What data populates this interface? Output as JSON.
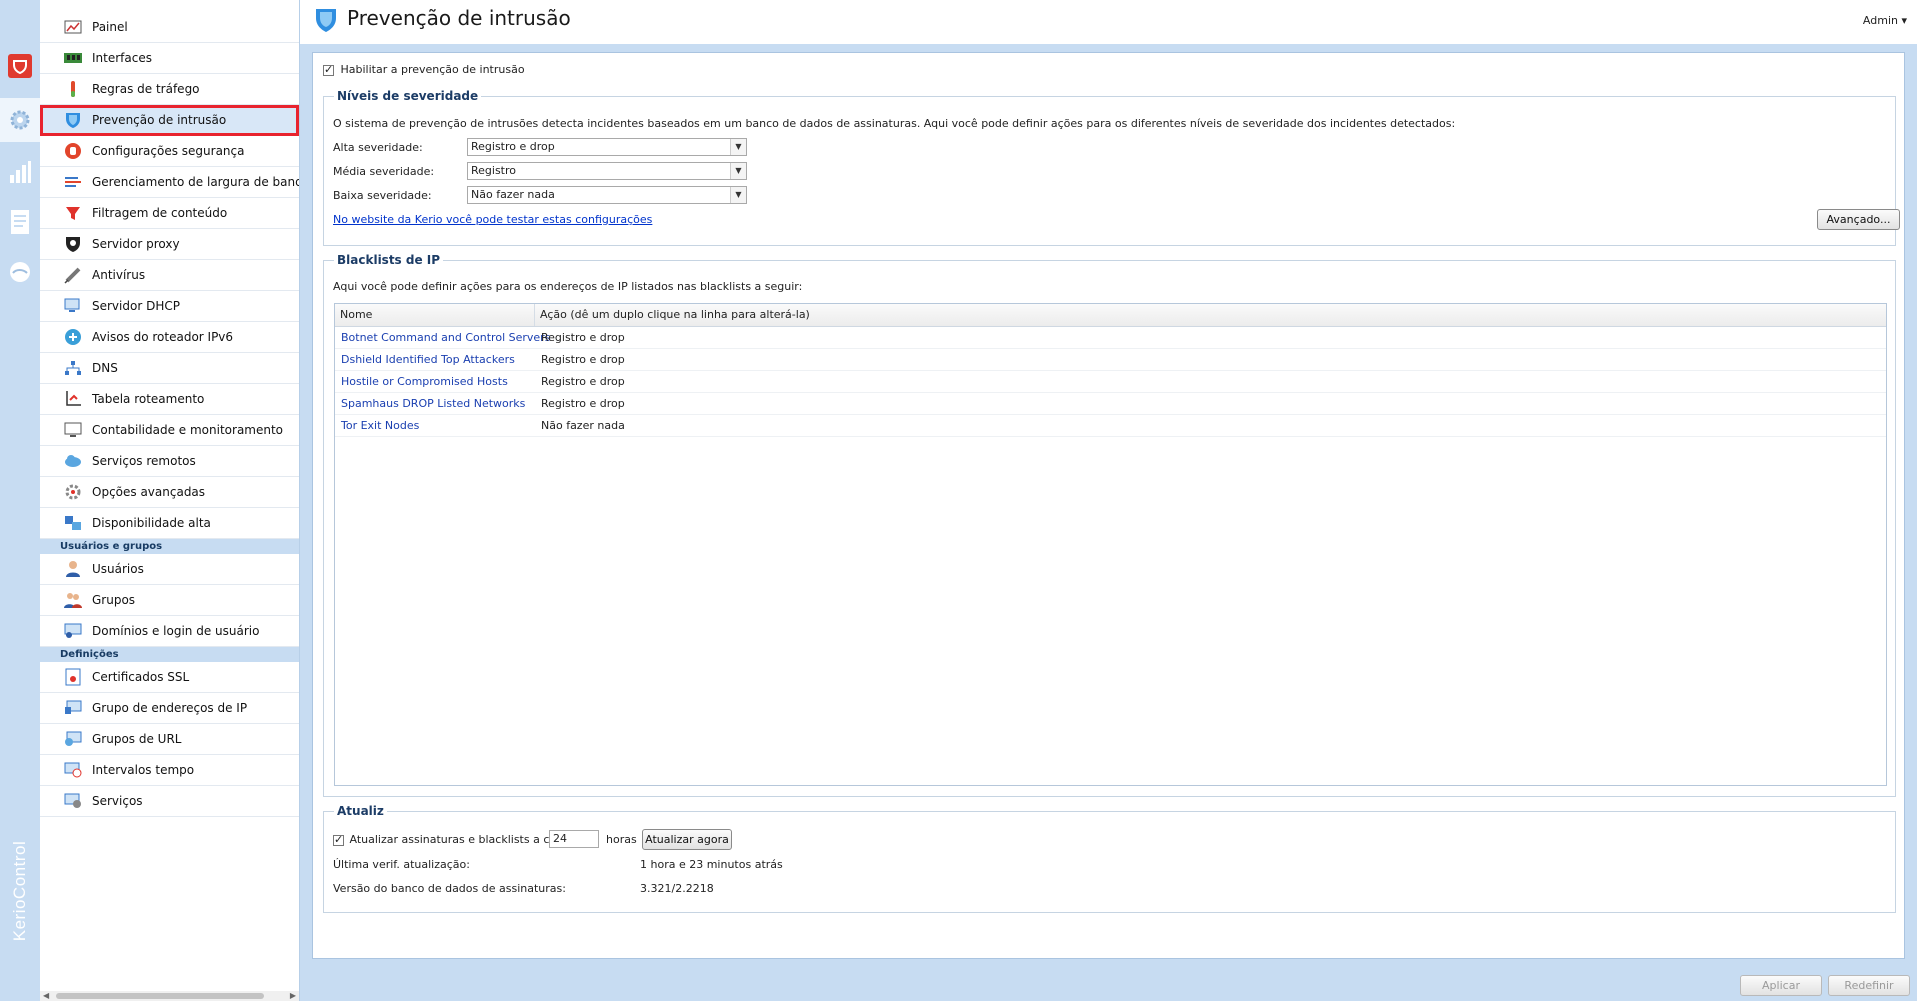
{
  "rail": {
    "brand": "KerioControl",
    "items": [
      "shield-icon",
      "gear-icon",
      "chart-icon",
      "document-icon",
      "bubble-icon"
    ]
  },
  "sidebar": {
    "items": [
      {
        "label": "Painel",
        "icon": "dashboard-icon"
      },
      {
        "label": "Interfaces",
        "icon": "network-card-icon"
      },
      {
        "label": "Regras de tráfego",
        "icon": "traffic-rule-icon"
      },
      {
        "label": "Prevenção de intrusão",
        "icon": "shield-icon"
      },
      {
        "label": "Configurações segurança",
        "icon": "hand-icon"
      },
      {
        "label": "Gerenciamento de largura de banda e QoS",
        "icon": "bandwidth-icon"
      },
      {
        "label": "Filtragem de conteúdo",
        "icon": "funnel-icon"
      },
      {
        "label": "Servidor proxy",
        "icon": "proxy-icon"
      },
      {
        "label": "Antivírus",
        "icon": "syringe-icon"
      },
      {
        "label": "Servidor DHCP",
        "icon": "dhcp-icon"
      },
      {
        "label": "Avisos do roteador IPv6",
        "icon": "router-icon"
      },
      {
        "label": "DNS",
        "icon": "dns-icon"
      },
      {
        "label": "Tabela roteamento",
        "icon": "routing-icon"
      },
      {
        "label": "Contabilidade e monitoramento",
        "icon": "monitor-icon"
      },
      {
        "label": "Serviços remotos",
        "icon": "cloud-icon"
      },
      {
        "label": "Opções avançadas",
        "icon": "advanced-icon"
      },
      {
        "label": "Disponibilidade alta",
        "icon": "cluster-icon"
      }
    ],
    "section_users": "Usuários e grupos",
    "users_items": [
      {
        "label": "Usuários",
        "icon": "user-icon"
      },
      {
        "label": "Grupos",
        "icon": "group-icon"
      },
      {
        "label": "Domínios e login de usuário",
        "icon": "domain-icon"
      }
    ],
    "section_defs": "Definições",
    "defs_items": [
      {
        "label": "Certificados SSL",
        "icon": "certificate-icon"
      },
      {
        "label": "Grupo de endereços de IP",
        "icon": "ip-group-icon"
      },
      {
        "label": "Grupos de URL",
        "icon": "url-group-icon"
      },
      {
        "label": "Intervalos tempo",
        "icon": "clock-icon"
      },
      {
        "label": "Serviços",
        "icon": "services-icon"
      }
    ]
  },
  "header": {
    "title": "Prevenção de intrusão",
    "user": "Admin ▾"
  },
  "enable": {
    "label": "Habilitar a prevenção de intrusão",
    "checked": true
  },
  "severity": {
    "legend": "Níveis de severidade",
    "description": "O sistema de prevenção de intrusões detecta incidentes baseados em um banco de dados de assinaturas. Aqui você pode definir ações para os diferentes níveis de severidade dos incidentes detectados:",
    "high_label": "Alta severidade:",
    "high_value": "Registro e drop",
    "medium_label": "Média severidade:",
    "medium_value": "Registro",
    "low_label": "Baixa severidade:",
    "low_value": "Não fazer nada",
    "test_link": "No website da Kerio você pode testar estas configurações",
    "advanced_button": "Avançado..."
  },
  "blacklists": {
    "legend": "Blacklists de IP",
    "description": "Aqui você pode definir ações para os endereços de IP listados nas blacklists a seguir:",
    "col_name": "Nome",
    "col_action": "Ação (dê um duplo clique na linha para alterá-la)",
    "rows": [
      {
        "name": "Botnet Command and Control Servers",
        "action": "Registro e drop"
      },
      {
        "name": "Dshield Identified Top Attackers",
        "action": "Registro e drop"
      },
      {
        "name": "Hostile or Compromised Hosts",
        "action": "Registro e drop"
      },
      {
        "name": "Spamhaus DROP Listed Networks",
        "action": "Registro e drop"
      },
      {
        "name": "Tor Exit Nodes",
        "action": "Não fazer nada"
      }
    ]
  },
  "update": {
    "legend": "Atualiz",
    "auto_label": "Atualizar assinaturas e blacklists a cada",
    "auto_checked": true,
    "hours_value": "24",
    "hours_unit": "horas",
    "update_now": "Atualizar agora",
    "last_check_label": "Última verif. atualização:",
    "last_check_value": "1 hora e 23 minutos atrás",
    "db_version_label": "Versão do banco de dados de assinaturas:",
    "db_version_value": "3.321/2.2218"
  },
  "footer": {
    "apply": "Aplicar",
    "reset": "Redefinir"
  },
  "colors": {
    "accent": "#c7dcf2",
    "selection_outline": "#e8232e",
    "link": "#0033cc"
  }
}
